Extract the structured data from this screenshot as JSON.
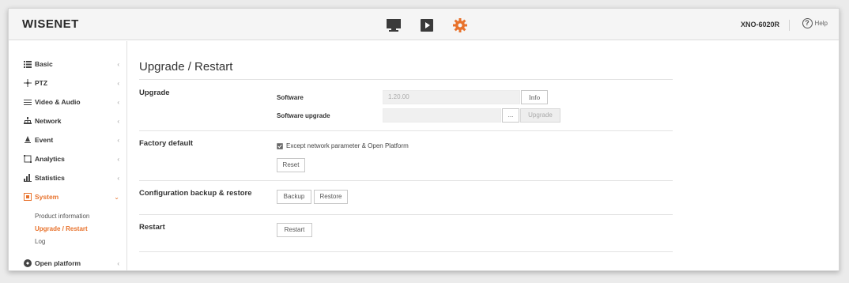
{
  "header": {
    "logo": "WISENET",
    "nav_icons": [
      "monitor-icon",
      "play-icon",
      "gear-icon"
    ],
    "model": "XNO-6020R",
    "help_label": "Help"
  },
  "sidebar": {
    "items": [
      {
        "label": "Basic",
        "icon": "list-icon"
      },
      {
        "label": "PTZ",
        "icon": "ptz-icon"
      },
      {
        "label": "Video & Audio",
        "icon": "video-audio-icon"
      },
      {
        "label": "Network",
        "icon": "network-icon"
      },
      {
        "label": "Event",
        "icon": "event-icon"
      },
      {
        "label": "Analytics",
        "icon": "analytics-icon"
      },
      {
        "label": "Statistics",
        "icon": "statistics-icon"
      },
      {
        "label": "System",
        "icon": "system-icon"
      },
      {
        "label": "Open platform",
        "icon": "open-platform-icon"
      }
    ],
    "system_sub": [
      "Product information",
      "Upgrade / Restart",
      "Log"
    ]
  },
  "main": {
    "title": "Upgrade / Restart",
    "upgrade": {
      "title": "Upgrade",
      "software_label": "Software",
      "software_value": "1.20.00",
      "info_button": "Info",
      "software_upgrade_label": "Software upgrade",
      "upgrade_file_value": "",
      "browse_button": "...",
      "upgrade_button": "Upgrade"
    },
    "factory": {
      "title": "Factory default",
      "checkbox_label": "Except network parameter & Open Platform",
      "checkbox_checked": true,
      "reset_button": "Reset"
    },
    "config": {
      "title": "Configuration backup & restore",
      "backup_button": "Backup",
      "restore_button": "Restore"
    },
    "restart": {
      "title": "Restart",
      "restart_button": "Restart"
    }
  },
  "colors": {
    "accent": "#e8722c",
    "header_bg": "#f5f5f5",
    "page_bg": "#ebebeb"
  }
}
